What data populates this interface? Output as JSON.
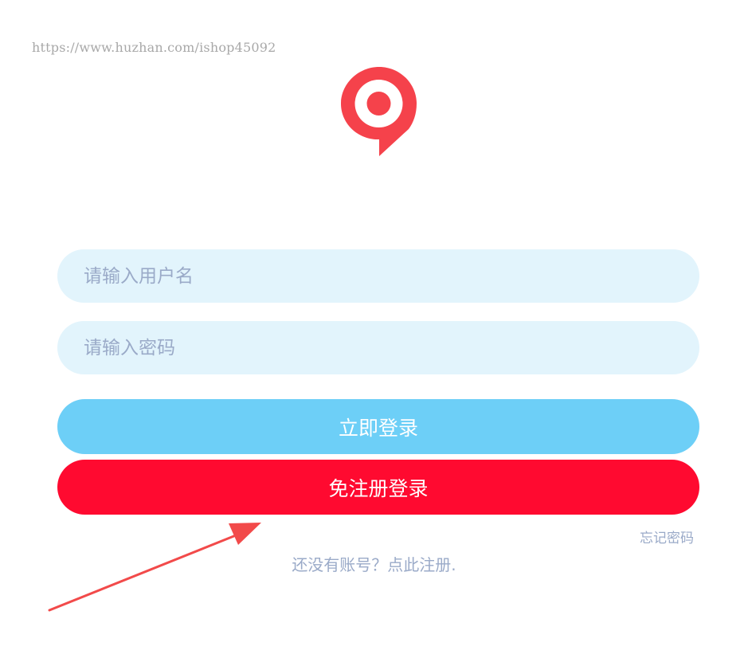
{
  "watermark": {
    "text": "https://www.huzhan.com/ishop45092"
  },
  "logo": {
    "icon": "location-pin-icon",
    "color": "#f5424b"
  },
  "form": {
    "username_placeholder": "请输入用户名",
    "password_placeholder": "请输入密码"
  },
  "buttons": {
    "login_label": "立即登录",
    "login_color": "#6dcff7",
    "quick_login_label": "免注册登录",
    "quick_login_color": "#ff0a30"
  },
  "links": {
    "forgot_password": "忘记密码",
    "register": "还没有账号？点此注册."
  },
  "annotation": {
    "icon": "arrow-icon",
    "color": "#f24a4a"
  }
}
